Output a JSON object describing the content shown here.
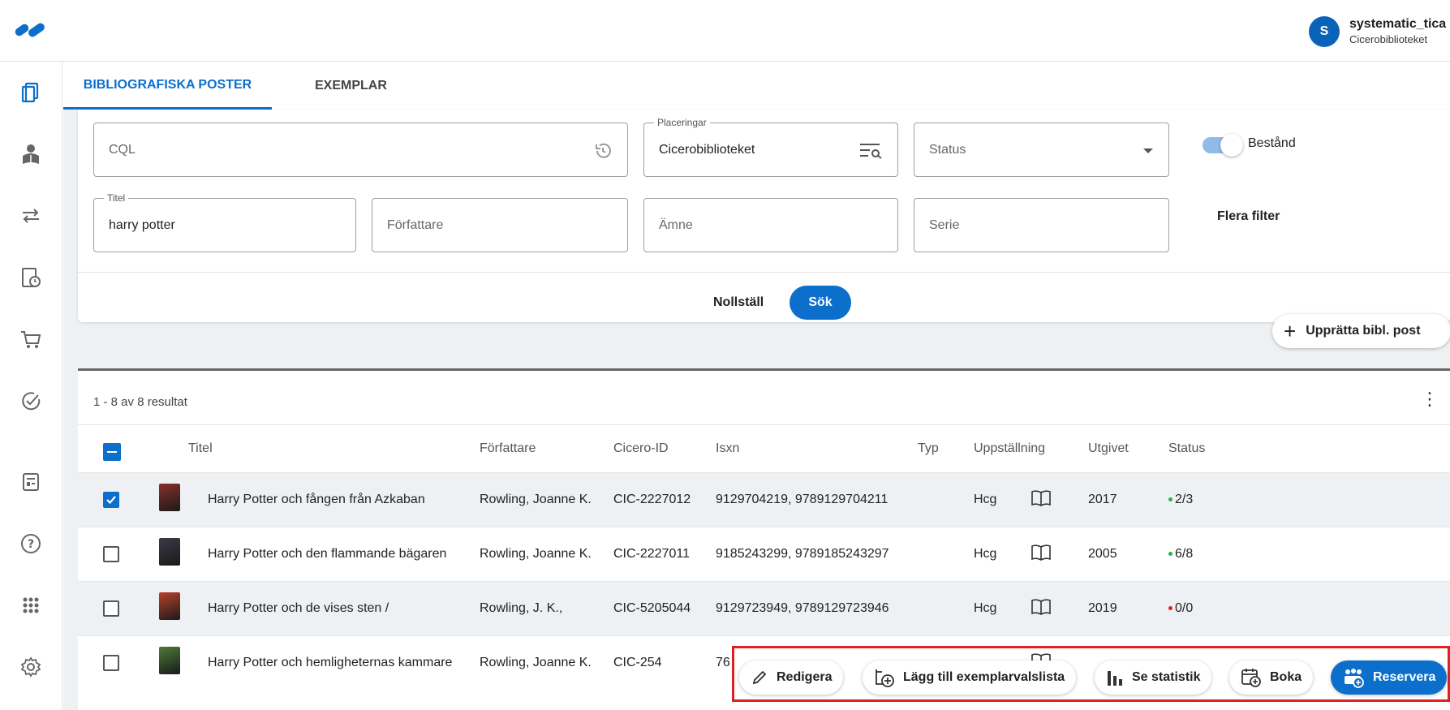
{
  "user": {
    "initial": "S",
    "name": "systematic_tica",
    "org": "Cicerobiblioteket"
  },
  "tabs": [
    {
      "label": "BIBLIOGRAFISKA POSTER",
      "active": true
    },
    {
      "label": "EXEMPLAR",
      "active": false
    }
  ],
  "search": {
    "cql_placeholder": "CQL",
    "placement_legend": "Placeringar",
    "placement_value": "Cicerobiblioteket",
    "status_placeholder": "Status",
    "stock_toggle_label": "Bestånd",
    "stock_toggle_on": true,
    "title_legend": "Titel",
    "title_value": "harry potter",
    "author_placeholder": "Författare",
    "subject_placeholder": "Ämne",
    "series_placeholder": "Serie",
    "more_filters_label": "Flera filter",
    "reset_label": "Nollställ",
    "search_label": "Sök"
  },
  "create_record_label": "Upprätta bibl. post",
  "results": {
    "count_text": "1 - 8 av 8 resultat",
    "columns": [
      "Titel",
      "Författare",
      "Cicero-ID",
      "Isxn",
      "Typ",
      "Uppställning",
      "Utgivet",
      "Status"
    ],
    "rows": [
      {
        "checked": true,
        "title": "Harry Potter och fången från Azkaban",
        "author": "Rowling, Joanne K.",
        "id": "CIC-2227012",
        "isxn": "9129704219, 9789129704211",
        "type": "book-icon",
        "shelf": "Hcg",
        "year": "2017",
        "status": "2/3",
        "status_color": "#2eae4a",
        "cover_color": "#8a2f2a"
      },
      {
        "checked": false,
        "title": "Harry Potter och den flammande bägaren",
        "author": "Rowling, Joanne K.",
        "id": "CIC-2227011",
        "isxn": "9185243299, 9789185243297",
        "type": "book-icon",
        "shelf": "Hcg",
        "year": "2005",
        "status": "6/8",
        "status_color": "#2eae4a",
        "cover_color": "#3a3a48"
      },
      {
        "checked": false,
        "title": "Harry Potter och de vises sten /",
        "author": "Rowling, J. K.,",
        "id": "CIC-5205044",
        "isxn": "9129723949, 9789129723946",
        "type": "book-icon",
        "shelf": "Hcg",
        "year": "2019",
        "status": "0/0",
        "status_color": "#e02020",
        "cover_color": "#b8412c"
      },
      {
        "checked": false,
        "title": "Harry Potter och hemligheternas kammare",
        "author": "Rowling, Joanne K.",
        "id": "CIC-254",
        "isxn": "76",
        "type": "book-icon",
        "shelf": "",
        "year": "",
        "status": "",
        "status_color": "#2eae4a",
        "cover_color": "#4d7a3a"
      }
    ]
  },
  "actions": {
    "edit": "Redigera",
    "add_to_list": "Lägg till exemplarvalslista",
    "statistics": "Se statistik",
    "book": "Boka",
    "reserve": "Reservera"
  },
  "colors": {
    "accent": "#0b6fcb",
    "highlight_border": "#e02020"
  }
}
